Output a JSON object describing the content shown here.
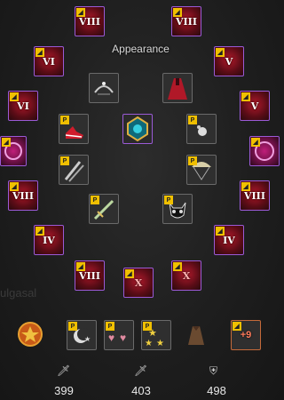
{
  "panel": {
    "title": "Appearance"
  },
  "background": {
    "left_name": "ulgasal"
  },
  "slots": {
    "top_left": {
      "rank": "VIII",
      "tag": "🗡"
    },
    "top_right": {
      "rank": "VIII",
      "tag": "🗡"
    },
    "row2_left": {
      "rank": "VI"
    },
    "row2_right": {
      "rank": "V"
    },
    "row3_left": {
      "rank": "VI"
    },
    "row3_right": {
      "rank": "V"
    },
    "mid_left_rank": {
      "rank": "VIII"
    },
    "mid_right_rank": {
      "rank": "VIII"
    },
    "low_left": {
      "rank": "IV"
    },
    "low_right": {
      "rank": "IV"
    },
    "bottom_left": {
      "rank": "VIII"
    },
    "bottom_center": {
      "rank": "X"
    },
    "bottom_right": {
      "rank": "X"
    },
    "enhance": {
      "label": "+9"
    },
    "tag_p": "P"
  },
  "stats": {
    "attack": "399",
    "awakening": "403",
    "defense": "498"
  }
}
